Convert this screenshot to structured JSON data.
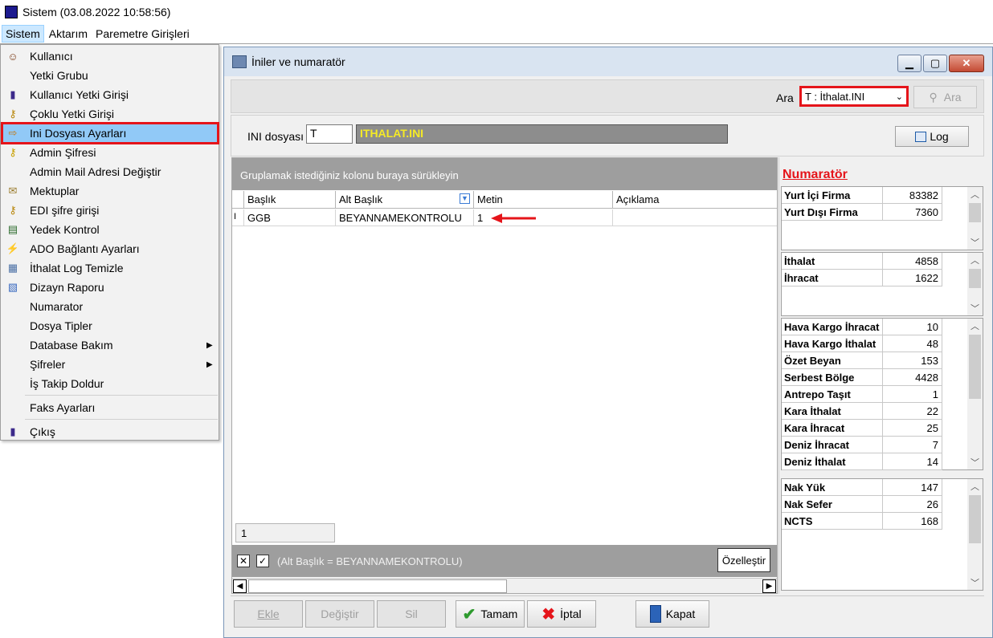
{
  "app": {
    "title": "Sistem (03.08.2022 10:58:56)"
  },
  "menubar": {
    "items": [
      "Sistem",
      "Aktarım",
      "Paremetre Girişleri"
    ]
  },
  "system_menu": {
    "items": [
      {
        "label": "Kullanıcı",
        "icon": "user-icon"
      },
      {
        "label": "Yetki Grubu",
        "icon": ""
      },
      {
        "label": "Kullanıcı Yetki Girişi",
        "icon": "key-user-icon"
      },
      {
        "label": "Çoklu Yetki Girişi",
        "icon": "multi-key-icon"
      },
      {
        "label": "Ini Dosyası  Ayarları",
        "icon": "ini-settings-icon"
      },
      {
        "label": "Admin Şifresi",
        "icon": "key-icon"
      },
      {
        "label": "Admin Mail Adresi Değiştir",
        "icon": ""
      },
      {
        "label": "Mektuplar",
        "icon": "letter-icon"
      },
      {
        "label": "EDI şifre girişi",
        "icon": "edi-key-icon"
      },
      {
        "label": "Yedek Kontrol",
        "icon": "backup-icon"
      },
      {
        "label": "ADO Bağlantı Ayarları",
        "icon": "connection-icon"
      },
      {
        "label": "İthalat Log Temizle",
        "icon": "log-clean-icon"
      },
      {
        "label": "Dizayn Raporu",
        "icon": "report-icon"
      },
      {
        "label": "Numarator",
        "icon": ""
      },
      {
        "label": "Dosya Tipler",
        "icon": ""
      },
      {
        "label": "Database Bakım",
        "icon": "",
        "submenu": true
      },
      {
        "label": "Şifreler",
        "icon": "",
        "submenu": true
      },
      {
        "label": "İş Takip Doldur",
        "icon": ""
      },
      {
        "label": "Faks Ayarları",
        "icon": ""
      },
      {
        "label": "Çıkış",
        "icon": "exit-icon"
      }
    ]
  },
  "window": {
    "title": "İniler ve numaratör",
    "search": {
      "label": "Ara",
      "selected": "T : İthalat.INI",
      "button": "Ara"
    },
    "ini": {
      "label": "INI dosyası",
      "code": "T",
      "name": "ITHALAT.INI",
      "log_button": "Log"
    },
    "grid": {
      "group_hint": "Gruplamak istediğiniz kolonu buraya sürükleyin",
      "columns": [
        "Başlık",
        "Alt Başlık",
        "Metin",
        "Açıklama"
      ],
      "rows": [
        {
          "indicator": "I",
          "cells": [
            "GGB",
            "BEYANNAMEKONTROLU",
            "1",
            ""
          ]
        }
      ],
      "footer_count": "1",
      "filter_text": "(Alt Başlık = BEYANNAMEKONTROLU)",
      "customize_button": "Özelleştir"
    },
    "numarator": {
      "title": "Numaratör",
      "groups": [
        [
          {
            "label": "Yurt İçi Firma",
            "value": "83382"
          },
          {
            "label": "Yurt Dışı Firma",
            "value": "7360"
          }
        ],
        [
          {
            "label": "İthalat",
            "value": "4858"
          },
          {
            "label": "İhracat",
            "value": "1622"
          }
        ],
        [
          {
            "label": "Hava Kargo İhracat",
            "value": "10"
          },
          {
            "label": "Hava Kargo İthalat",
            "value": "48"
          },
          {
            "label": "Özet Beyan",
            "value": "153"
          },
          {
            "label": "Serbest Bölge",
            "value": "4428"
          },
          {
            "label": "Antrepo Taşıt",
            "value": "1"
          },
          {
            "label": "Kara İthalat",
            "value": "22"
          },
          {
            "label": "Kara İhracat",
            "value": "25"
          },
          {
            "label": "Deniz İhracat",
            "value": "7"
          },
          {
            "label": "Deniz İthalat",
            "value": "14"
          }
        ],
        [
          {
            "label": "Nak Yük",
            "value": "147"
          },
          {
            "label": "Nak Sefer",
            "value": "26"
          },
          {
            "label": "NCTS",
            "value": "168"
          }
        ]
      ]
    },
    "buttons": {
      "ekle": "Ekle",
      "degistir": "Değiştir",
      "sil": "Sil",
      "tamam": "Tamam",
      "iptal": "İptal",
      "kapat": "Kapat"
    }
  },
  "colors": {
    "highlight_red": "#e5141a",
    "ini_name_text": "#f5ea26",
    "menu_selected": "#91c9f7"
  }
}
